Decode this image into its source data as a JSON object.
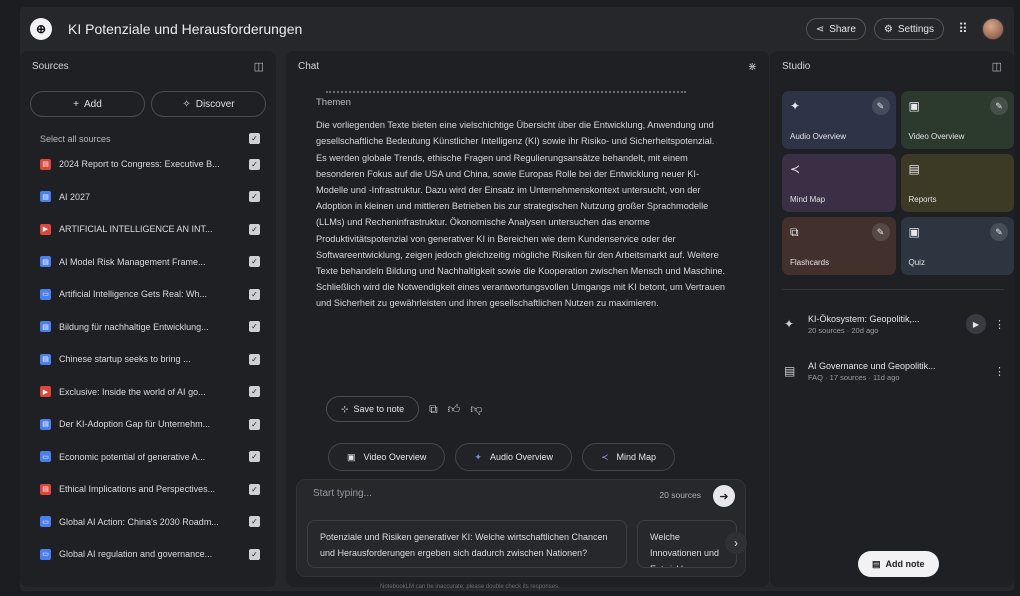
{
  "app": {
    "title": "KI Potenziale und Herausforderungen",
    "share_label": "Share",
    "settings_label": "Settings"
  },
  "colors": {
    "background": "#1c1d20",
    "panel": "#1f2023",
    "tile_purple_blue": "#2e3348",
    "tile_green": "#2c3a2e",
    "tile_purple": "#3a2f44",
    "tile_olive": "#3c3a24",
    "tile_brown": "#42302c",
    "tile_slate": "#2d3640"
  },
  "sources": {
    "title": "Sources",
    "add_label": "Add",
    "discover_label": "Discover",
    "select_all_label": "Select all sources",
    "items": [
      {
        "label": "2024 Report to Congress: Executive B...",
        "icon": "pdf-icon",
        "color": "#e0453a"
      },
      {
        "label": "AI 2027",
        "icon": "doc-icon",
        "color": "#4a7ff0"
      },
      {
        "label": "ARTIFICIAL INTELLIGENCE AN INT...",
        "icon": "youtube-icon",
        "color": "#e0453a"
      },
      {
        "label": "AI Model Risk Management Frame...",
        "icon": "doc-icon",
        "color": "#4a7ff0"
      },
      {
        "label": "Artificial Intelligence Gets Real: Wh...",
        "icon": "web-icon",
        "color": "#4a7ff0"
      },
      {
        "label": "Bildung für nachhaltige Entwicklung...",
        "icon": "doc-icon",
        "color": "#4a7ff0"
      },
      {
        "label": "Chinese startup seeks to bring ...",
        "icon": "doc-icon",
        "color": "#4a7ff0"
      },
      {
        "label": "Exclusive: Inside the world of AI go...",
        "icon": "youtube-icon",
        "color": "#e0453a"
      },
      {
        "label": "Der KI-Adoption Gap für Unternehm...",
        "icon": "doc-icon",
        "color": "#4a7ff0"
      },
      {
        "label": "Economic potential of generative A...",
        "icon": "web-icon",
        "color": "#4a7ff0"
      },
      {
        "label": "Ethical Implications and Perspectives...",
        "icon": "pdf-icon",
        "color": "#e0453a"
      },
      {
        "label": "Global AI Action: China's 2030 Roadm...",
        "icon": "web-icon",
        "color": "#4a7ff0"
      },
      {
        "label": "Global AI regulation and governance...",
        "icon": "web-icon",
        "color": "#4a7ff0"
      }
    ]
  },
  "chat": {
    "title": "Chat",
    "heading": "Themen",
    "body": "Die vorliegenden Texte bieten eine vielschichtige Übersicht über die Entwicklung, Anwendung und gesellschaftliche Bedeutung Künstlicher Intelligenz (KI) sowie ihr Risiko- und Sicherheitspotenzial. Es werden globale Trends, ethische Fragen und Regulierungsansätze behandelt, mit einem besonderen Fokus auf die USA und China, sowie Europas Rolle bei der Entwicklung neuer KI-Modelle und -Infrastruktur. Dazu wird der Einsatz im Unternehmenskontext untersucht, von der Adoption in kleinen und mittleren Betrieben bis zur strategischen Nutzung großer Sprachmodelle (LLMs) und Recheninfrastruktur. Ökonomische Analysen untersuchen das enorme Produktivitätspotenzial von generativer KI in Bereichen wie dem Kundenservice oder der Softwareentwicklung, zeigen jedoch gleichzeitig mögliche Risiken für den Arbeitsmarkt auf. Weitere Texte behandeln Bildung und Nachhaltigkeit sowie die Kooperation zwischen Mensch und Maschine. Schließlich wird die Notwendigkeit eines verantwortungsvollen Umgangs mit KI betont, um Vertrauen und Sicherheit zu gewährleisten und ihren gesellschaftlichen Nutzen zu maximieren.",
    "save_note_label": "Save to note",
    "suggest_buttons": [
      {
        "label": "Video Overview",
        "icon": "video-icon"
      },
      {
        "label": "Audio Overview",
        "icon": "audio-icon"
      },
      {
        "label": "Mind Map",
        "icon": "mindmap-icon"
      }
    ],
    "input_placeholder": "Start typing...",
    "source_count": "20 sources",
    "suggestions": [
      "Potenziale und Risiken generativer KI: Welche wirtschaftlichen Chancen und Herausforderungen ergeben sich dadurch zwischen Nationen?",
      "Welche Innovationen und Entwicklungen treiben die..."
    ]
  },
  "studio": {
    "title": "Studio",
    "tiles": [
      {
        "label": "Audio Overview",
        "icon": "audio-icon",
        "color": "#2e3348",
        "editable": true
      },
      {
        "label": "Video Overview",
        "icon": "video-icon",
        "color": "#2c3a2e",
        "editable": true
      },
      {
        "label": "Mind Map",
        "icon": "mindmap-icon",
        "color": "#3a2f44",
        "editable": false
      },
      {
        "label": "Reports",
        "icon": "report-icon",
        "color": "#3c3a24",
        "editable": false
      },
      {
        "label": "Flashcards",
        "icon": "flashcard-icon",
        "color": "#42302c",
        "editable": true
      },
      {
        "label": "Quiz",
        "icon": "quiz-icon",
        "color": "#2d3640",
        "editable": true
      }
    ],
    "notes": [
      {
        "title": "KI-Ökosystem: Geopolitik,...",
        "meta": "20 sources · 20d ago",
        "icon": "audio-icon",
        "has_play": true
      },
      {
        "title": "AI Governance und Geopolitik...",
        "meta": "FAQ · 17 sources · 11d ago",
        "icon": "report-icon",
        "has_play": false
      }
    ],
    "add_note_label": "Add note"
  },
  "footer": {
    "disclaimer": "NotebookLM can be inaccurate; please double check its responses."
  }
}
